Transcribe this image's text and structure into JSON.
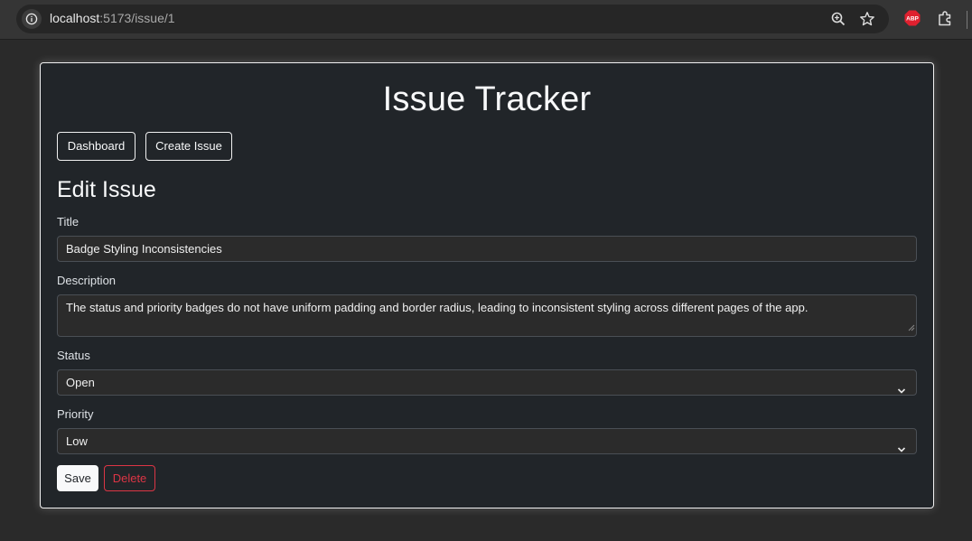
{
  "browser": {
    "url_host": "localhost",
    "url_path": ":5173/issue/1",
    "icons": [
      "info-icon",
      "zoom-icon",
      "bookmark-star-icon",
      "adblock-icon",
      "extensions-puzzle-icon"
    ],
    "adblock_label": "ABP"
  },
  "app": {
    "title": "Issue Tracker",
    "nav": {
      "dashboard_label": "Dashboard",
      "create_issue_label": "Create Issue"
    }
  },
  "form": {
    "heading": "Edit Issue",
    "title_label": "Title",
    "title_value": "Badge Styling Inconsistencies",
    "description_label": "Description",
    "description_value": "The status and priority badges do not have uniform padding and border radius, leading to inconsistent styling across different pages of the app.",
    "status_label": "Status",
    "status_value": "Open",
    "priority_label": "Priority",
    "priority_value": "Low",
    "save_label": "Save",
    "delete_label": "Delete"
  },
  "colors": {
    "page_bg": "#2a2a2a",
    "card_bg": "#212529",
    "danger": "#dc3545",
    "light": "#f8f9fa",
    "adblock_red": "#e0202f"
  }
}
